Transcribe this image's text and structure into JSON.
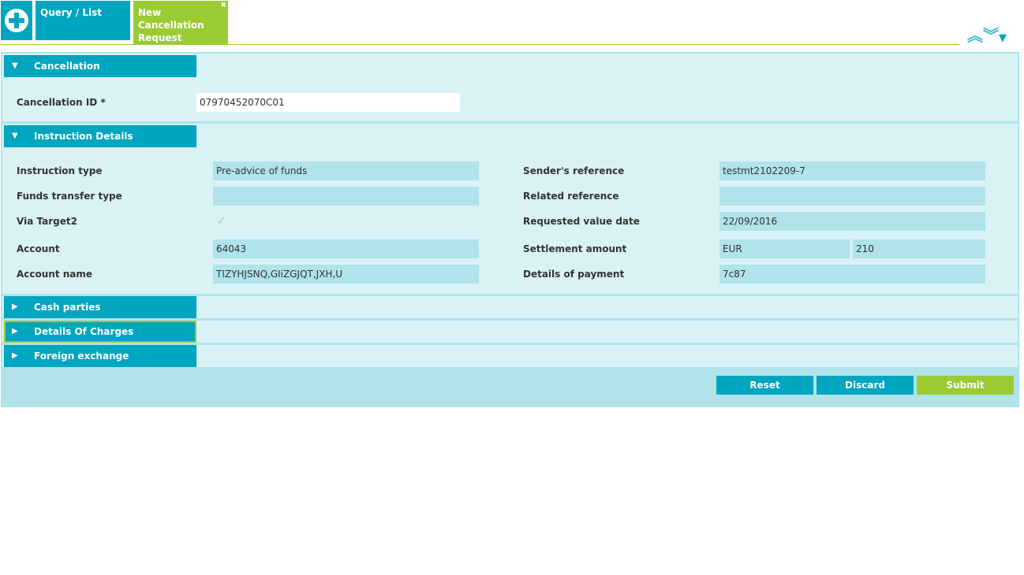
{
  "tabs": {
    "query": "Query / List",
    "active": "New Cancellation Request",
    "close": "✖"
  },
  "toolbar": {
    "collapse": "︽",
    "expand": "︾",
    "menu": "▼"
  },
  "sections": {
    "cancellation": {
      "title": "Cancellation",
      "id_label": "Cancellation ID *",
      "id_value": "07970452070C01"
    },
    "instruction": {
      "title": "Instruction Details",
      "left": [
        {
          "label": "Instruction type",
          "value": "Pre-advice of funds"
        },
        {
          "label": "Funds transfer type",
          "value": ""
        },
        {
          "label": "Via Target2",
          "value": "✓"
        },
        {
          "label": "Account",
          "value": "64043"
        },
        {
          "label": "Account name",
          "value": "TIZYHJSNQ,GIiZGJQT,JXH,U"
        }
      ],
      "right": [
        {
          "label": "Sender's reference",
          "value": "testmt2102209-7"
        },
        {
          "label": "Related reference",
          "value": ""
        },
        {
          "label": "Requested value date",
          "value": "22/09/2016"
        },
        {
          "label": "Settlement amount",
          "currency": "EUR",
          "value": "210"
        },
        {
          "label": "Details of payment",
          "value": "7c87"
        }
      ]
    },
    "cash": {
      "title": "Cash parties"
    },
    "charges": {
      "title": "Details Of Charges"
    },
    "fx": {
      "title": "Foreign exchange"
    }
  },
  "buttons": {
    "reset": "Reset",
    "discard": "Discard",
    "submit": "Submit"
  },
  "colors": {
    "primary": "#00a5c0",
    "accent": "#9acb34",
    "panel": "#b0e3ea",
    "section": "#d9f2f6"
  }
}
